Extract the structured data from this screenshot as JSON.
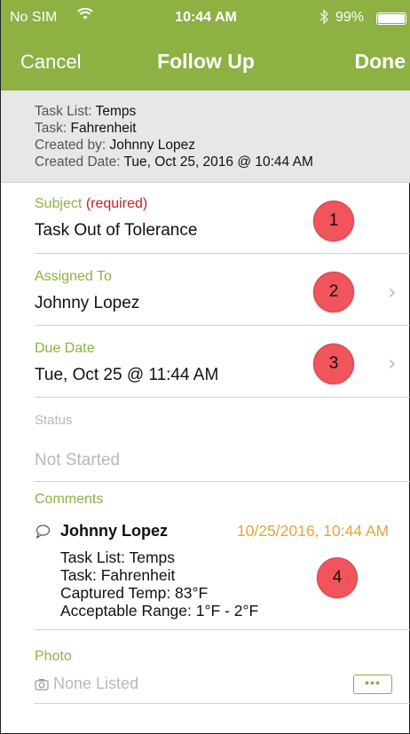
{
  "status_bar": {
    "carrier": "No SIM",
    "wifi_icon": "wifi-icon",
    "time": "10:44 AM",
    "bluetooth_icon": "bluetooth-icon",
    "battery_percent": "99%",
    "battery_level": 0.99
  },
  "nav": {
    "cancel_label": "Cancel",
    "title": "Follow Up",
    "done_label": "Done"
  },
  "info": {
    "task_list_key": "Task List:",
    "task_list": "Temps",
    "task_key": "Task:",
    "task": "Fahrenheit",
    "created_by_key": "Created by:",
    "created_by": "Johnny Lopez",
    "created_date_key": "Created Date:",
    "created_date": "Tue, Oct 25, 2016 @ 10:44 AM"
  },
  "subject": {
    "label": "Subject",
    "required": "(required)",
    "value": "Task Out of Tolerance",
    "badge": "1"
  },
  "assigned_to": {
    "label": "Assigned To",
    "value": "Johnny Lopez",
    "badge": "2"
  },
  "due_date": {
    "label": "Due Date",
    "value": "Tue, Oct 25 @ 11:44 AM",
    "badge": "3"
  },
  "status": {
    "label": "Status",
    "value": "Not Started"
  },
  "comments": {
    "label": "Comments",
    "items": [
      {
        "icon": "speech-bubble-icon",
        "author": "Johnny Lopez",
        "date": "10/25/2016, 10:44 AM",
        "lines": [
          "Task List: Temps",
          "Task: Fahrenheit",
          "Captured Temp: 83°F",
          "Acceptable Range: 1°F - 2°F"
        ]
      }
    ],
    "badge": "4"
  },
  "photo": {
    "label": "Photo",
    "icon": "camera-icon",
    "value": "None Listed",
    "more_label": "•••"
  },
  "colors": {
    "accent": "#8db143",
    "required": "#c8201f",
    "badge": "#f2545b",
    "date": "#e8a33a",
    "info_bg": "#e7e7e7"
  }
}
